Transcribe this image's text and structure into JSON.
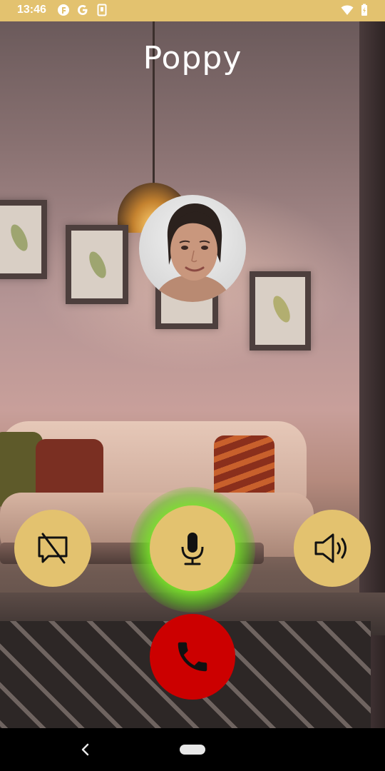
{
  "status_bar": {
    "time": "13:46",
    "icons": [
      "f-app-icon",
      "google-icon",
      "sim-card-icon",
      "wifi-icon",
      "battery-icon"
    ]
  },
  "call": {
    "contact_name": "Poppy",
    "avatar": "avatar-portrait"
  },
  "controls": {
    "chat": {
      "icon": "chat-off-icon"
    },
    "mic": {
      "icon": "microphone-icon",
      "active": true
    },
    "speaker": {
      "icon": "speaker-icon"
    },
    "end_call": {
      "icon": "phone-icon"
    }
  },
  "colors": {
    "accent": "#e3c26f",
    "end_call": "#cc0000",
    "mic_active_glow": "#7de62a"
  },
  "nav_bar": {
    "icons": [
      "back-icon",
      "home-pill-icon"
    ]
  }
}
